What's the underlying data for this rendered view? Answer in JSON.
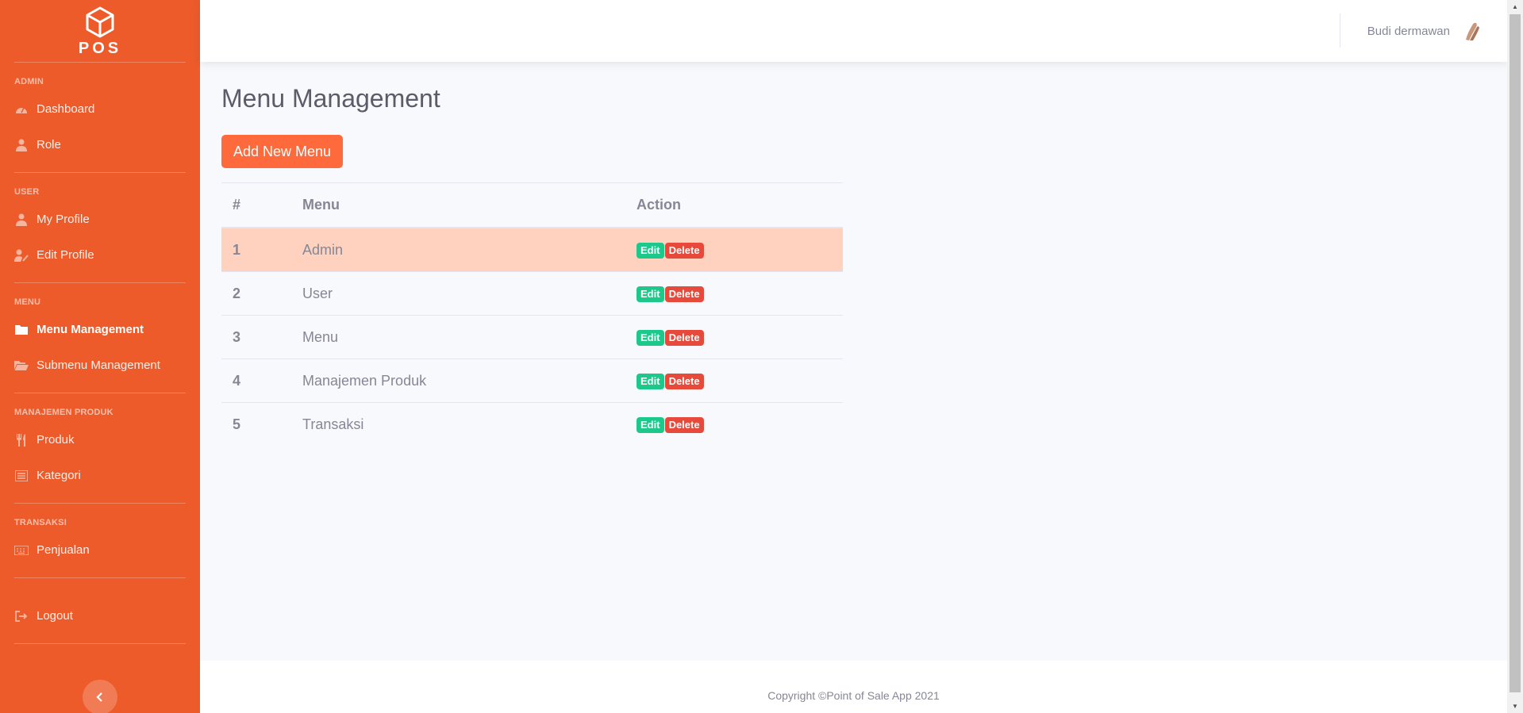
{
  "brand": {
    "text": "POS",
    "icon": "cube-icon"
  },
  "sidebar": {
    "sections": [
      {
        "heading": "ADMIN",
        "items": [
          {
            "label": "Dashboard",
            "icon": "tachometer-icon"
          },
          {
            "label": "Role",
            "icon": "user-tie-icon"
          }
        ]
      },
      {
        "heading": "USER",
        "items": [
          {
            "label": "My Profile",
            "icon": "user-icon"
          },
          {
            "label": "Edit Profile",
            "icon": "user-edit-icon"
          }
        ]
      },
      {
        "heading": "MENU",
        "items": [
          {
            "label": "Menu Management",
            "icon": "folder-icon",
            "active": true
          },
          {
            "label": "Submenu Management",
            "icon": "folder-open-icon"
          }
        ]
      },
      {
        "heading": "MANAJEMEN PRODUK",
        "items": [
          {
            "label": "Produk",
            "icon": "utensils-icon"
          },
          {
            "label": "Kategori",
            "icon": "list-icon"
          }
        ]
      },
      {
        "heading": "TRANSAKSI",
        "items": [
          {
            "label": "Penjualan",
            "icon": "keyboard-icon"
          }
        ]
      }
    ],
    "logout": {
      "label": "Logout",
      "icon": "sign-out-icon"
    },
    "toggle_icon": "chevron-left-icon"
  },
  "topbar": {
    "user_name": "Budi dermawan",
    "avatar_icon": "avatar-icon"
  },
  "main": {
    "title": "Menu Management",
    "add_button": "Add New Menu",
    "table": {
      "headers": [
        "#",
        "Menu",
        "Action"
      ],
      "rows": [
        {
          "num": "1",
          "menu": "Admin",
          "highlight": true
        },
        {
          "num": "2",
          "menu": "User"
        },
        {
          "num": "3",
          "menu": "Menu"
        },
        {
          "num": "4",
          "menu": "Manajemen Produk"
        },
        {
          "num": "5",
          "menu": "Transaksi"
        }
      ],
      "edit_label": "Edit",
      "delete_label": "Delete"
    }
  },
  "footer": {
    "copyright": "Copyright ©Point of Sale App 2021"
  },
  "colors": {
    "sidebar": "#ed5b2b",
    "accent_button": "#ff6a3d",
    "row_highlight": "#ffd1bf",
    "edit": "#1cc88a",
    "delete": "#e74a3b"
  }
}
